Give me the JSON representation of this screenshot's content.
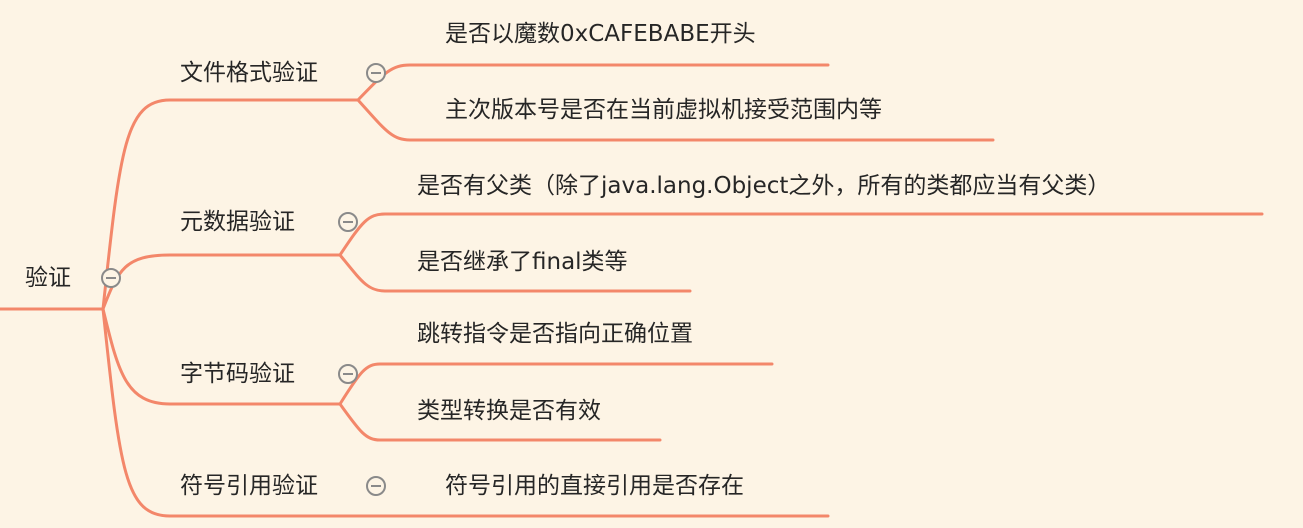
{
  "colors": {
    "background": "#fdf4e5",
    "branch": "#f3876a",
    "text": "#262626",
    "toggle": "#8a8a8a"
  },
  "root": {
    "label": "验证"
  },
  "branches": [
    {
      "label": "文件格式验证",
      "children": [
        "是否以魔数0xCAFEBABE开头",
        "主次版本号是否在当前虚拟机接受范围内等"
      ]
    },
    {
      "label": "元数据验证",
      "children": [
        "是否有父类（除了java.lang.Object之外，所有的类都应当有父类）",
        "是否继承了final类等"
      ]
    },
    {
      "label": "字节码验证",
      "children": [
        "跳转指令是否指向正确位置",
        "类型转换是否有效"
      ]
    },
    {
      "label": "符号引用验证",
      "children": [
        "符号引用的直接引用是否存在"
      ]
    }
  ]
}
